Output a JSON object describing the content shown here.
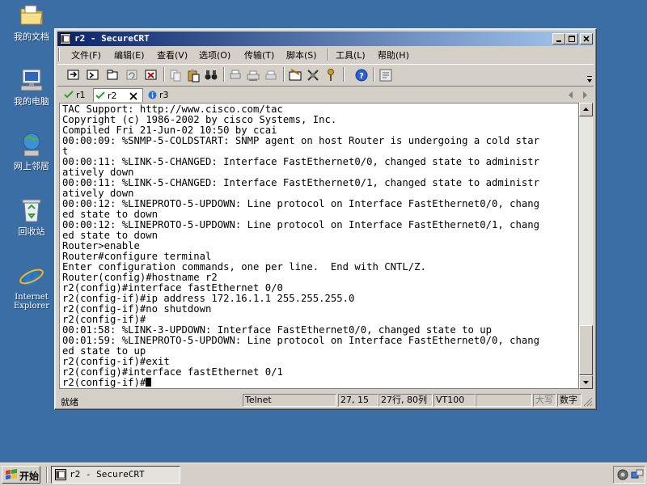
{
  "desktop": {
    "icons": [
      {
        "label": "我的文档",
        "icon": "folder-documents-icon"
      },
      {
        "label": "我的电脑",
        "icon": "computer-icon"
      },
      {
        "label": "网上邻居",
        "icon": "network-icon"
      },
      {
        "label": "回收站",
        "icon": "recycle-bin-icon"
      },
      {
        "label": "Internet Explorer",
        "icon": "internet-explorer-icon"
      }
    ]
  },
  "window": {
    "title": "r2 - SecureCRT",
    "menu": [
      "文件(F)",
      "编辑(E)",
      "查看(V)",
      "选项(O)",
      "传输(T)",
      "脚本(S)",
      "工具(L)",
      "帮助(H)"
    ],
    "tabs": [
      {
        "label": "r1",
        "state": "connected"
      },
      {
        "label": "r2",
        "state": "connected",
        "active": true
      },
      {
        "label": "r3",
        "state": "info"
      }
    ],
    "terminal_lines": [
      "TAC Support: http://www.cisco.com/tac",
      "Copyright (c) 1986-2002 by cisco Systems, Inc.",
      "Compiled Fri 21-Jun-02 10:50 by ccai",
      "00:00:09: %SNMP-5-COLDSTART: SNMP agent on host Router is undergoing a cold star",
      "t",
      "00:00:11: %LINK-5-CHANGED: Interface FastEthernet0/0, changed state to administr",
      "atively down",
      "00:00:11: %LINK-5-CHANGED: Interface FastEthernet0/1, changed state to administr",
      "atively down",
      "00:00:12: %LINEPROTO-5-UPDOWN: Line protocol on Interface FastEthernet0/0, chang",
      "ed state to down",
      "00:00:12: %LINEPROTO-5-UPDOWN: Line protocol on Interface FastEthernet0/1, chang",
      "ed state to down",
      "Router>enable",
      "Router#configure terminal",
      "Enter configuration commands, one per line.  End with CNTL/Z.",
      "Router(config)#hostname r2",
      "r2(config)#interface fastEthernet 0/0",
      "r2(config-if)#ip address 172.16.1.1 255.255.255.0",
      "r2(config-if)#no shutdown",
      "r2(config-if)#",
      "00:01:58: %LINK-3-UPDOWN: Interface FastEthernet0/0, changed state to up",
      "00:01:59: %LINEPROTO-5-UPDOWN: Line protocol on Interface FastEthernet0/0, chang",
      "ed state to up",
      "r2(config-if)#exit",
      "r2(config)#interface fastEthernet 0/1"
    ],
    "prompt": "r2(config-if)#",
    "status": {
      "ready": "就绪",
      "protocol": "Telnet",
      "cursor_pos": "27, 15",
      "size": "27行, 80列",
      "emulation": "VT100",
      "caps": "大写",
      "num": "数字"
    }
  },
  "taskbar": {
    "start_label": "开始",
    "task_label": "r2 - SecureCRT"
  },
  "colors": {
    "desktop": "#3a6ea5",
    "titlebar_start": "#0a246a",
    "titlebar_end": "#a6caf0",
    "chrome": "#d4d0c8"
  }
}
